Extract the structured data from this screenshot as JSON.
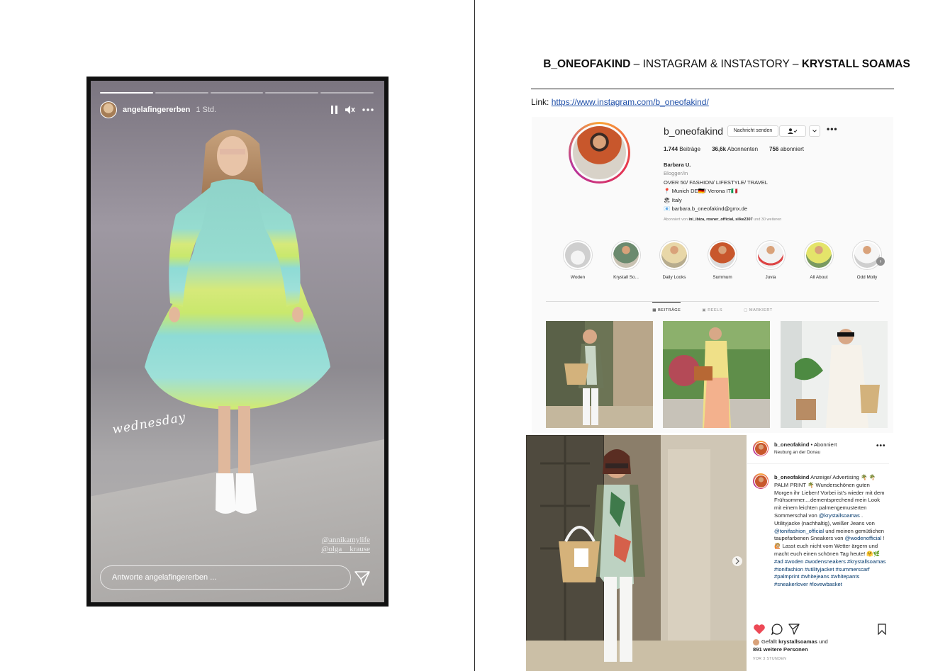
{
  "story": {
    "username": "angelafingererben",
    "time": "1 Std.",
    "sticker": "wednesday",
    "tags": [
      "@annikamylife",
      "@olga__krause"
    ],
    "reply_placeholder": "Antworte angelafingererben ...",
    "progress_segments": 5,
    "progress_done": 1
  },
  "document": {
    "title_brand": "B_ONEOFAKIND",
    "title_sep1": " – ",
    "title_middle": "INSTAGRAM & INSTASTORY",
    "title_sep2": " – ",
    "title_partner": "KRYSTALL SOAMAS",
    "link_label": "Link:",
    "link_url": "https://www.instagram.com/b_oneofakind/"
  },
  "profile": {
    "username": "b_oneofakind",
    "message_button": "Nachricht senden",
    "follow_icon": "user-check-icon",
    "dropdown_icon": "chevron-down-icon",
    "more": "•••",
    "posts_count": "1.744",
    "posts_label": "Beiträge",
    "followers_count": "36,6k",
    "followers_label": "Abonnenten",
    "following_count": "756",
    "following_label": "abonniert",
    "bio": {
      "name": "Barbara U.",
      "category": "Blogger/in",
      "line1": "OVER 50/ FASHION/ LIFESTYLE/ TRAVEL",
      "line2": "📍 Munich DE🇩🇪/ Verona IT🇮🇹",
      "line3": "🏖 Italy",
      "line4": "📧 barbara.b_oneofakind@gmx.de"
    },
    "followed_by_prefix": "Abonniert von",
    "followed_by_names": "ini_ibiza, rosner_official, silke2307",
    "followed_by_suffix": "und 30 weiteren",
    "highlights": [
      "Woden",
      "Krystall So...",
      "Daily Looks",
      "Summum",
      "Juvia",
      "All About",
      "Odd Molly"
    ],
    "tabs": [
      "BEITRÄGE",
      "REELS",
      "MARKIERT"
    ]
  },
  "post": {
    "username": "b_oneofakind",
    "follow_state": "• Abonniert",
    "location": "Neuburg an der Donau",
    "caption_user": "b_oneofakind",
    "caption_text": "Anzeige/ Advertising 🌴 🌴 PALM PRINT 🌴 Wunderschönen guten Morgen ihr Lieben! Vorbei ist's wieder mit dem Frühsommer....dementsprechend mein Look mit einem leichten palmengemusterten Sommerschal von",
    "mention1": "@krystallsoamas",
    "caption_text2": ". Utilityjacke (nachhaltig), weißer Jeans von",
    "mention2": "@tonifashion_official",
    "caption_text3": "und meinen gemütlichen taupefarbenen Sneakers von",
    "mention3": "@wodenofficial",
    "caption_text4": "! 🙋🏼 Lasst euch nicht vom Wetter ärgern und macht euch einen schönen Tag heute! 🤗🌿",
    "hashtags": "#ad #woden #wodensneakers #krystallsoamas #tonifashion #utilityjacket #summerscarf #palmprint #whitejeans #whitepants #sneakerlover #lovewbasket",
    "liked_by_prefix": "Gefällt",
    "liked_by_user": "krystallsoamas",
    "liked_by_conj": "und",
    "liked_by_rest": "891 weitere Personen",
    "time": "VOR 3 STUNDEN"
  },
  "colors": {
    "like_red": "#ed4956",
    "link_blue": "#1f4fa8",
    "ig_text": "#262626",
    "ig_muted": "#8e8e8e"
  }
}
